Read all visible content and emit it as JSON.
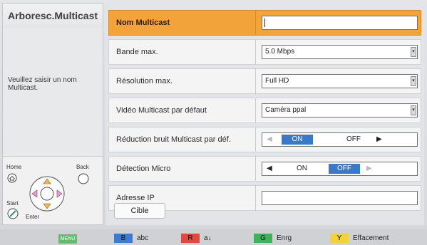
{
  "left_panel": {
    "title": "Arboresc.Multicast",
    "help_text": "Veuillez saisir un nom Multicast."
  },
  "remote": {
    "home": "Home",
    "back": "Back",
    "start": "Start",
    "enter": "Enter"
  },
  "settings": [
    {
      "label": "Nom Multicast",
      "type": "text",
      "value": ""
    },
    {
      "label": "Bande max.",
      "type": "select",
      "value": "5.0 Mbps"
    },
    {
      "label": "Résolution max.",
      "type": "select",
      "value": "Full HD"
    },
    {
      "label": "Vidéo Multicast par défaut",
      "type": "select",
      "value": "Caméra ppal"
    },
    {
      "label": "Réduction bruit Multicast par déf.",
      "type": "toggle",
      "on": "ON",
      "off": "OFF",
      "selected": "ON"
    },
    {
      "label": "Détection Micro",
      "type": "toggle",
      "on": "ON",
      "off": "OFF",
      "selected": "OFF"
    },
    {
      "label": "Adresse IP",
      "type": "text",
      "value": ""
    }
  ],
  "cible_button": "Cible",
  "footer": {
    "menu": "MENU",
    "keys": [
      {
        "chip": "B",
        "label": "abc",
        "color": "#3d7bd0"
      },
      {
        "chip": "R",
        "label": "a↓",
        "color": "#e0493f"
      },
      {
        "chip": "G",
        "label": "Enrg",
        "color": "#3fb35c"
      },
      {
        "chip": "Y",
        "label": "Effacement",
        "color": "#f0d23a"
      }
    ]
  },
  "colors": {
    "active_row": "#f2a33a",
    "toggle_on": "#3a78c8"
  }
}
